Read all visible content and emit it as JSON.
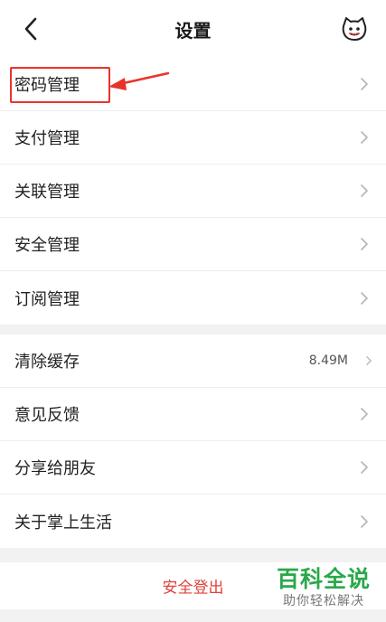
{
  "header": {
    "title": "设置",
    "back_icon": "chevron-left-icon",
    "right_icon": "cat-mascot-icon"
  },
  "group1": {
    "items": [
      {
        "label": "密码管理"
      },
      {
        "label": "支付管理"
      },
      {
        "label": "关联管理"
      },
      {
        "label": "安全管理"
      },
      {
        "label": "订阅管理"
      }
    ]
  },
  "group2": {
    "items": [
      {
        "label": "清除缓存",
        "value": "8.49M"
      },
      {
        "label": "意见反馈"
      },
      {
        "label": "分享给朋友"
      },
      {
        "label": "关于掌上生活"
      }
    ]
  },
  "logout": {
    "label": "安全登出"
  },
  "watermark": {
    "main": "百科全说",
    "sub": "助你轻松解决"
  },
  "colors": {
    "accent_red": "#e0413a",
    "annotation_red": "#e8332b",
    "watermark_green": "#2aa84a",
    "background": "#f2f2f2"
  }
}
